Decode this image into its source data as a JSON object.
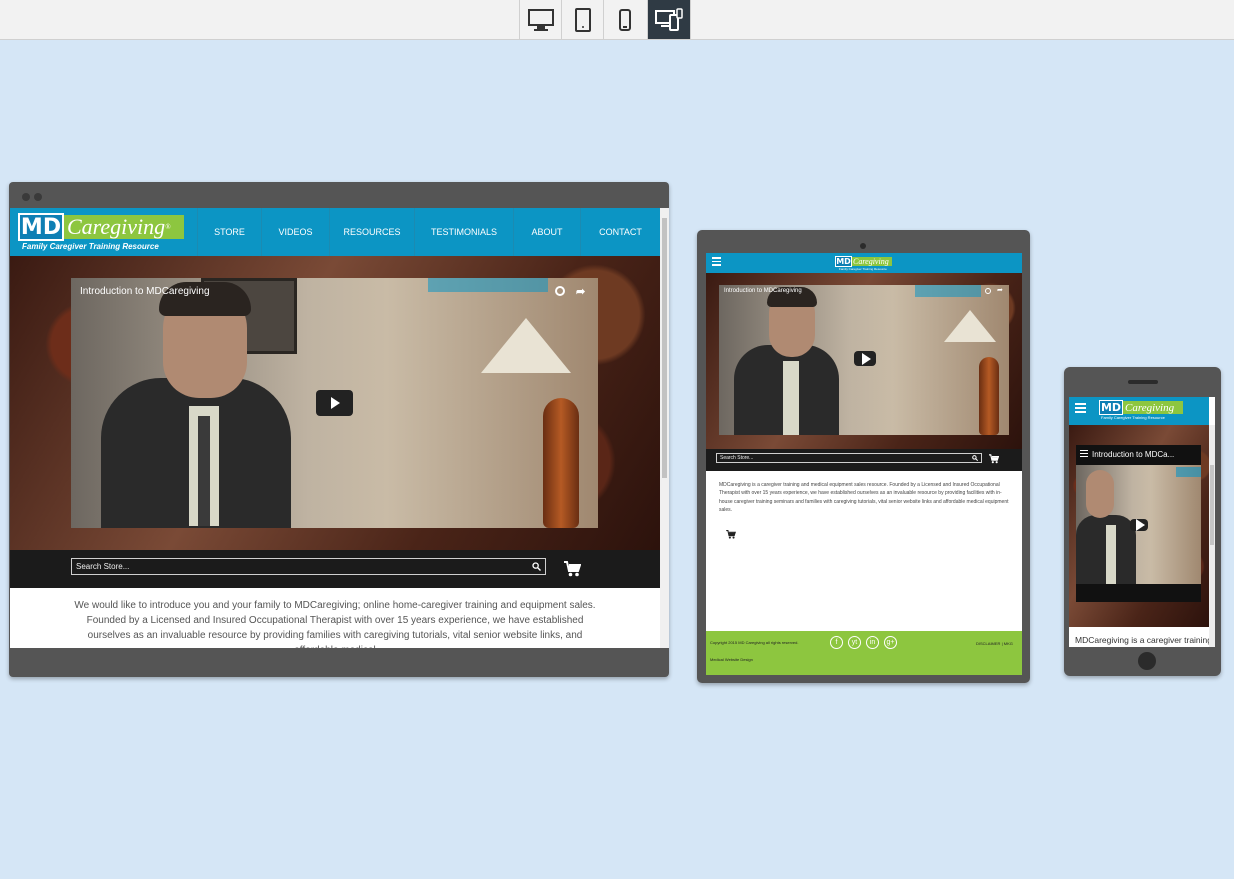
{
  "toolbar": {
    "devices": [
      {
        "icon": "desktop-icon",
        "active": false
      },
      {
        "icon": "tablet-icon",
        "active": false
      },
      {
        "icon": "phone-icon",
        "active": false
      },
      {
        "icon": "multi-device-icon",
        "active": true
      }
    ]
  },
  "brand": {
    "logo_md": "MD",
    "logo_caregiving": "Caregiving",
    "logo_reg": "®",
    "tagline": "Family Caregiver Training Resource"
  },
  "nav": [
    "STORE",
    "VIDEOS",
    "RESOURCES",
    "TESTIMONIALS",
    "ABOUT",
    "CONTACT"
  ],
  "video": {
    "title": "Introduction to MDCaregiving",
    "title_short": "Introduction to MDCa..."
  },
  "search": {
    "placeholder_desktop": "Search Store...",
    "placeholder_tablet": "Search Store..."
  },
  "desktop_text": "We would like to introduce you and your family to MDCaregiving; online home-caregiver training and equipment sales. Founded by a Licensed and Insured Occupational Therapist with over 15 years experience, we have established ourselves as an invaluable resource by providing families with caregiving tutorials, vital senior website links, and affordable medical",
  "tablet_text": "MDCaregiving is a caregiver training and medical equipment sales resource. Founded by a Licensed and Insured Occupational Therapist with over 15 years experience, we have established ourselves as an invaluable resource by providing facilities with in-house caregiver training seminars and families with caregiving tutorials, vital senior website links and affordable medical equipment sales.",
  "phone_text": "MDCaregiving is a caregiver training",
  "footer": {
    "copyright": "Copyright 2015 MD Caregiving all rights reserved.",
    "credit": "Medical Website Design",
    "disclaimer": "DISCLAIMER",
    "sep": "|",
    "links": "MKG",
    "social": [
      "f",
      "yt",
      "in",
      "g+"
    ]
  },
  "colors": {
    "header_blue": "#0c95c4",
    "green": "#8dc63f",
    "frame": "#555555"
  }
}
